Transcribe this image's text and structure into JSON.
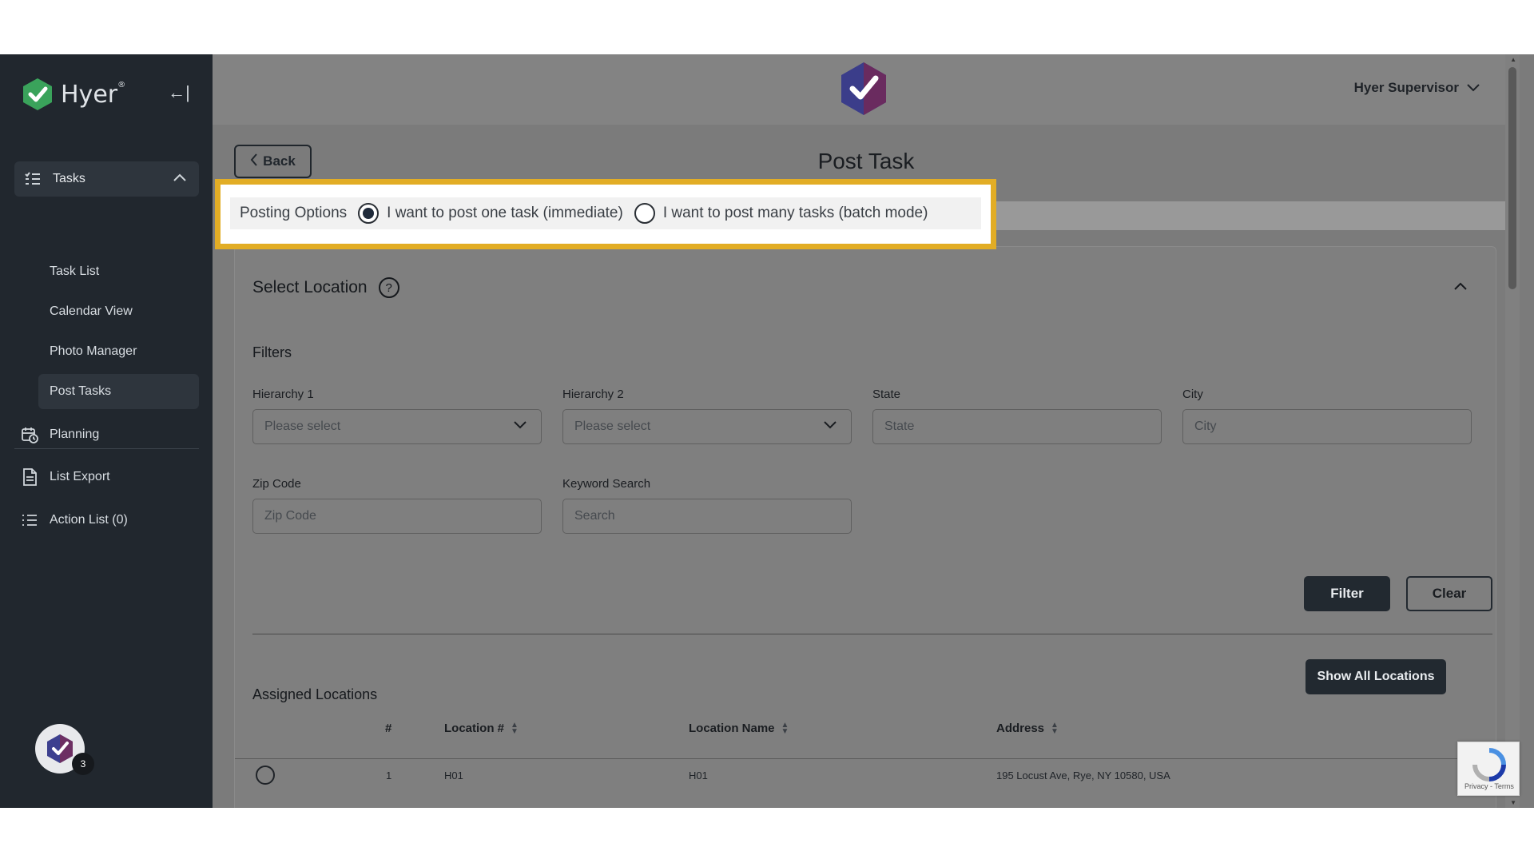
{
  "sidebar": {
    "brand": "Hyer",
    "brand_mark": "®",
    "collapse_glyph": "←|",
    "tasks_group": {
      "label": "Tasks",
      "subitems": [
        "Task List",
        "Calendar View",
        "Photo Manager",
        "Post Tasks"
      ],
      "active": "Post Tasks"
    },
    "planning": "Planning",
    "list_export": "List Export",
    "action_list": "Action List (0)",
    "avatar_badge": "3"
  },
  "header": {
    "user": "Hyer Supervisor",
    "back": "Back",
    "page_title": "Post Task"
  },
  "posting_options": {
    "label": "Posting Options",
    "option_one": "I want to post one task (immediate)",
    "option_many": "I want to post many tasks (batch mode)",
    "selected": "one"
  },
  "select_location": {
    "title": "Select Location",
    "help": "?",
    "filters_title": "Filters",
    "hierarchy1": {
      "label": "Hierarchy 1",
      "placeholder": "Please select"
    },
    "hierarchy2": {
      "label": "Hierarchy 2",
      "placeholder": "Please select"
    },
    "state": {
      "label": "State",
      "placeholder": "State"
    },
    "city": {
      "label": "City",
      "placeholder": "City"
    },
    "zip": {
      "label": "Zip Code",
      "placeholder": "Zip Code"
    },
    "keyword": {
      "label": "Keyword Search",
      "placeholder": "Search"
    },
    "filter_button": "Filter",
    "clear_button": "Clear"
  },
  "assigned_locations": {
    "title": "Assigned Locations",
    "show_all": "Show All Locations",
    "columns": [
      "#",
      "Location #",
      "Location Name",
      "Address"
    ],
    "rows": [
      {
        "num": "1",
        "location_no": "H01",
        "location_name": "H01",
        "address": "195 Locust Ave, Rye, NY 10580, USA"
      }
    ]
  },
  "recaptcha": "Privacy - Terms",
  "colors": {
    "highlight": "#e2ad25",
    "sidebar": "#21272e",
    "primary_button": "#222930"
  }
}
